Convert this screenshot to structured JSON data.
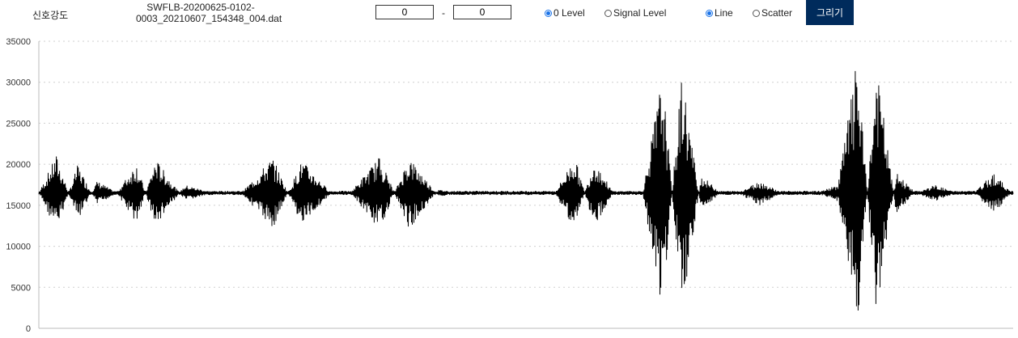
{
  "toolbar": {
    "page_label": "신호강도",
    "file_name_line1": "SWFLB-20200625-0102-",
    "file_name_line2": "0003_20210607_154348_004.dat",
    "range_start": "0",
    "range_sep": "-",
    "range_end": "0",
    "level_options": [
      {
        "label": "0 Level",
        "checked": true
      },
      {
        "label": "Signal Level",
        "checked": false
      }
    ],
    "plot_options": [
      {
        "label": "Line",
        "checked": true
      },
      {
        "label": "Scatter",
        "checked": false
      }
    ],
    "draw_button": "그리기",
    "accent_color": "#002b5c"
  },
  "chart_data": {
    "type": "line",
    "title": "",
    "xlabel": "",
    "ylabel": "",
    "ylim": [
      0,
      35000
    ],
    "yticks": [
      "0",
      "5000",
      "10000",
      "15000",
      "20000",
      "25000",
      "30000",
      "35000"
    ],
    "grid": "horizontal dotted",
    "baseline": 16500,
    "series_color": "#000000",
    "series": [
      {
        "x": [
          0,
          1.8,
          4,
          6,
          8,
          10,
          12,
          15,
          18,
          21,
          24,
          27,
          30,
          32,
          35,
          38,
          41,
          44,
          47,
          50,
          53,
          55,
          57,
          59,
          60,
          62,
          64,
          66,
          68,
          70,
          72,
          74,
          76,
          78,
          80,
          82,
          84,
          86,
          88,
          90,
          92,
          94,
          96,
          98,
          100
        ],
        "y": [
          16500,
          21200,
          13000,
          18000,
          16500,
          20300,
          12300,
          17500,
          16500,
          16800,
          20900,
          12500,
          16500,
          16600,
          21000,
          12000,
          16900,
          16500,
          16400,
          16500,
          16600,
          21000,
          12300,
          16600,
          16500,
          16700,
          31200,
          1500,
          18700,
          16500,
          16700,
          18000,
          16700,
          16500,
          16600,
          17500,
          33000,
          700,
          19000,
          16500,
          17500,
          16600,
          16500,
          19000,
          16300
        ]
      }
    ]
  }
}
